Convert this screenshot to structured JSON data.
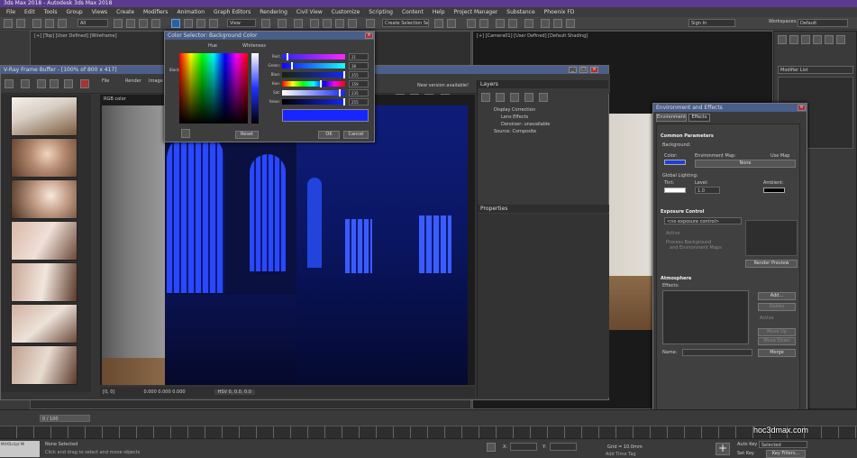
{
  "app": {
    "title": "3ds Max 2018 - Autodesk 3ds Max 2018"
  },
  "menu": [
    "File",
    "Edit",
    "Tools",
    "Group",
    "Views",
    "Create",
    "Modifiers",
    "Animation",
    "Graph Editors",
    "Rendering",
    "Civil View",
    "Customize",
    "Scripting",
    "Content",
    "Help",
    "Project Manager",
    "Substance",
    "Phoenix FD"
  ],
  "toolbar": {
    "filter_select": "All",
    "view_select": "View",
    "selection_set": "Create Selection Se",
    "sign_in": "Sign In",
    "workspaces_label": "Workspaces:",
    "workspace": "Default"
  },
  "viewports": {
    "left_label": "[+] [Top] [User Defined] [Wireframe]",
    "right_label": "[+] [Camera01] [User Defined] [Default Shading]"
  },
  "color_selector": {
    "title": "Color Selector: Background Color",
    "hue_label": "Hue",
    "whiteness_label": "Whiteness",
    "blackness_label": "Blackness",
    "channels": [
      {
        "label": "Red:",
        "value": "21",
        "percent": 8
      },
      {
        "label": "Green:",
        "value": "38",
        "percent": 15
      },
      {
        "label": "Blue:",
        "value": "255",
        "percent": 100
      },
      {
        "label": "Hue:",
        "value": "159",
        "percent": 62
      },
      {
        "label": "Sat:",
        "value": "235",
        "percent": 92
      },
      {
        "label": "Value:",
        "value": "255",
        "percent": 100
      }
    ],
    "swatch_color": "#1526ff",
    "reset": "Reset",
    "ok": "OK",
    "cancel": "Cancel"
  },
  "vfb": {
    "title": "V-Ray Frame Buffer - [100% of 800 x 417]",
    "menu": [
      "File",
      "Render",
      "Image"
    ],
    "channel_select": "RGB color",
    "new_version": "New version available!",
    "status_coords": "[0, 0]",
    "status_values": "0.000   0.000   0.000",
    "status_extra": "HSV 0, 0.0, 0.0",
    "layers_tab": "Layers",
    "layer_items": [
      "Display Correction",
      "Lens Effects",
      "Denoiser: unavailable",
      "Source: Composite"
    ],
    "properties_label": "Properties"
  },
  "env": {
    "title": "Environment and Effects",
    "tabs": [
      "Environment",
      "Effects"
    ],
    "common_params": "Common Parameters",
    "background_label": "Background:",
    "color_label": "Color:",
    "env_map_label": "Environment Map:",
    "use_map_label": "Use Map",
    "map_button": "None",
    "global_lighting": "Global Lighting:",
    "tint_label": "Tint:",
    "level_label": "Level:",
    "level_value": "1.0",
    "ambient_label": "Ambient:",
    "bg_color": "#1f3fd8",
    "exposure_title": "Exposure Control",
    "exposure_select": "<no exposure control>",
    "active_label": "Active",
    "process_bg_label": "Process Background",
    "env_maps_label": "and Environment Maps",
    "render_preview": "Render Preview",
    "atmosphere_title": "Atmosphere",
    "effects_label": "Effects:",
    "add": "Add...",
    "delete": "Delete",
    "active2": "Active",
    "move_up": "Move Up",
    "move_down": "Move Down",
    "name_label": "Name:",
    "merge": "Merge"
  },
  "right_panel": {
    "modifier_list": "Modifier List"
  },
  "timeline": {
    "frame": "0 / 100"
  },
  "status": {
    "selection": "None Selected",
    "prompt": "Click and drag to select and move objects",
    "x_label": "X:",
    "y_label": "Y:",
    "grid": "Grid = 10.0mm",
    "add_time_tag": "Add Time Tag",
    "auto_key": "Auto Key",
    "selected": "Selected",
    "set_key": "Set Key",
    "key_filters": "Key Filters...",
    "maxscript": "MAXScript Mi"
  },
  "watermark": "hoc3dmax.com"
}
